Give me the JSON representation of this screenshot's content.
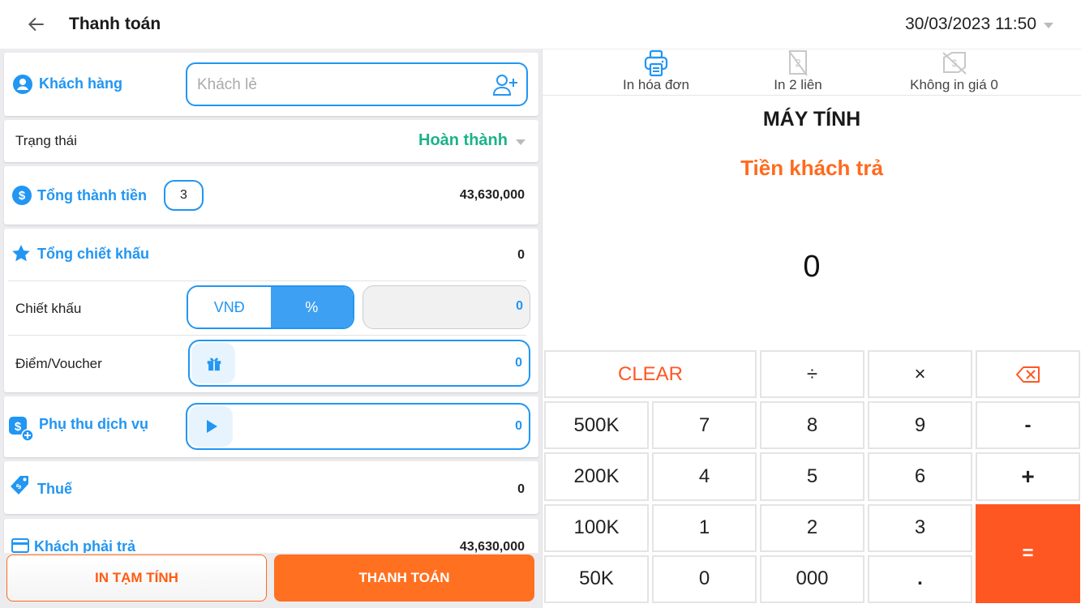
{
  "header": {
    "title": "Thanh toán",
    "datetime": "30/03/2023 11:50"
  },
  "customer": {
    "label": "Khách hàng",
    "placeholder": "Khách lẻ"
  },
  "status": {
    "label": "Trạng thái",
    "value": "Hoàn thành"
  },
  "subtotal": {
    "label": "Tổng thành tiền",
    "item_count": "3",
    "value": "43,630,000"
  },
  "discount": {
    "label": "Tổng chiết khấu",
    "value": "0",
    "discount_label": "Chiết khấu",
    "unit_options": [
      "VNĐ",
      "%"
    ],
    "selected_unit": "%",
    "discount_value": "0",
    "voucher_label": "Điểm/Voucher",
    "voucher_value": "0"
  },
  "service_fee": {
    "label": "Phụ thu dịch vụ",
    "value": "0"
  },
  "tax": {
    "label": "Thuế",
    "value": "0"
  },
  "total": {
    "label": "Khách phải trả",
    "value": "43,630,000"
  },
  "actions": {
    "print_temp": "IN TẠM TÍNH",
    "pay": "THANH TOÁN"
  },
  "print_options": [
    {
      "label": "In hóa đơn",
      "icon": "printer-icon",
      "active": true
    },
    {
      "label": "In 2 liên",
      "icon": "copy-off-icon",
      "active": false
    },
    {
      "label": "Không in giá 0",
      "icon": "price-off-icon",
      "active": false
    }
  ],
  "calculator": {
    "title": "MÁY TÍNH",
    "subtitle": "Tiền khách trả",
    "display": "0",
    "keys": {
      "clear": "CLEAR",
      "divide": "÷",
      "multiply": "×",
      "k500": "500K",
      "k200": "200K",
      "k100": "100K",
      "k50": "50K",
      "n7": "7",
      "n8": "8",
      "n9": "9",
      "n4": "4",
      "n5": "5",
      "n6": "6",
      "n1": "1",
      "n2": "2",
      "n3": "3",
      "n0": "0",
      "n000": "000",
      "dot": ".",
      "minus": "-",
      "plus": "+",
      "equals": "="
    }
  },
  "colors": {
    "primary": "#2196f3",
    "accent": "#ff6a1f",
    "status": "#1cb28a"
  }
}
